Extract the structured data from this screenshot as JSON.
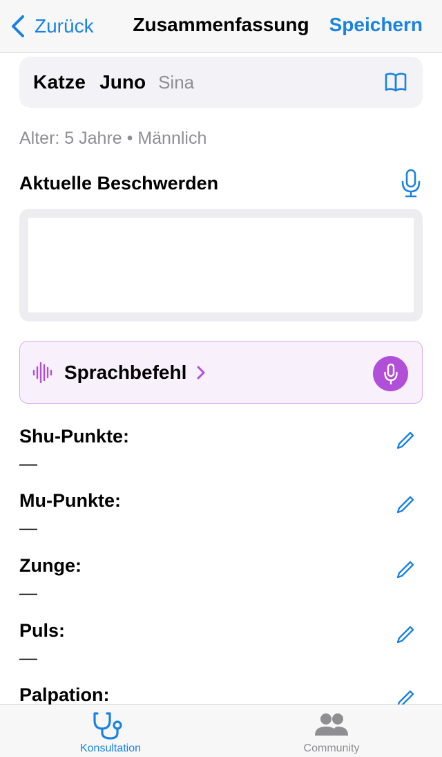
{
  "nav": {
    "back_label": "Zurück",
    "title": "Zusammenfassung",
    "save_label": "Speichern"
  },
  "patient": {
    "species": "Katze",
    "name": "Juno",
    "owner": "Sina",
    "meta": "Alter: 5 Jahre • Männlich"
  },
  "complaints": {
    "title": "Aktuelle Beschwerden",
    "value": ""
  },
  "voice_command": {
    "label": "Sprachbefehl"
  },
  "fields": [
    {
      "label": "Shu-Punkte:",
      "value": "—"
    },
    {
      "label": "Mu-Punkte:",
      "value": "—"
    },
    {
      "label": "Zunge:",
      "value": "—"
    },
    {
      "label": "Puls:",
      "value": "—"
    },
    {
      "label": "Palpation:",
      "value": ""
    }
  ],
  "tabs": [
    {
      "label": "Konsultation",
      "icon": "stethoscope-icon",
      "active": true
    },
    {
      "label": "Community",
      "icon": "people-icon",
      "active": false
    }
  ],
  "colors": {
    "accent": "#1a82e2",
    "voice_accent": "#b14fd9",
    "secondary_text": "#8e8e93"
  }
}
